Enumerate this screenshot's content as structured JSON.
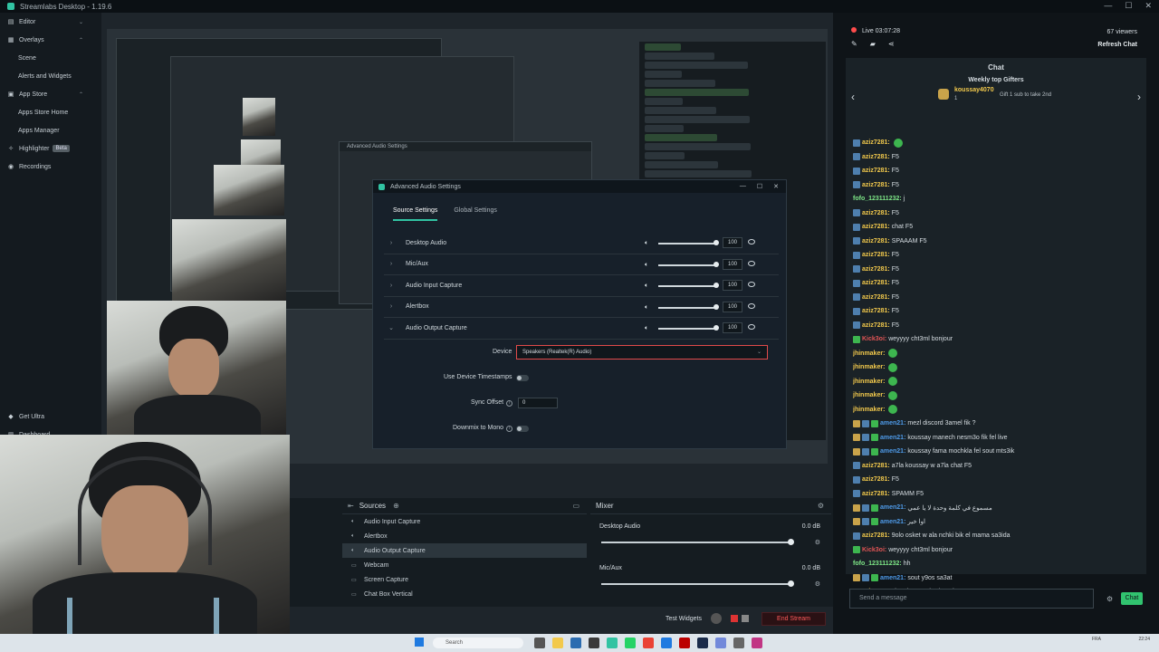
{
  "window": {
    "title": "Streamlabs Desktop - 1.19.6"
  },
  "sidebar": {
    "items": [
      {
        "label": "Editor",
        "level": 0
      },
      {
        "label": "Overlays",
        "level": 0
      },
      {
        "label": "Scene",
        "level": 1
      },
      {
        "label": "Alerts and Widgets",
        "level": 1
      },
      {
        "label": "App Store",
        "level": 0
      },
      {
        "label": "Apps Store Home",
        "level": 1
      },
      {
        "label": "Apps Manager",
        "level": 1
      },
      {
        "label": "Highlighter",
        "level": 0,
        "badge": "Beta"
      },
      {
        "label": "Recordings",
        "level": 0
      }
    ],
    "bottom": [
      {
        "label": "Get Ultra"
      },
      {
        "label": "Dashboard"
      }
    ]
  },
  "nested_dialog": {
    "title": "Advanced Audio Settings",
    "tabs": [
      "Source Settings",
      "Global Settings"
    ]
  },
  "audio_settings": {
    "title": "Advanced Audio Settings",
    "tabs": [
      "Source Settings",
      "Global Settings"
    ],
    "active_tab": "Source Settings",
    "rows": [
      {
        "name": "Desktop Audio",
        "value": "100",
        "expanded": false
      },
      {
        "name": "Mic/Aux",
        "value": "100",
        "expanded": false
      },
      {
        "name": "Audio Input Capture",
        "value": "100",
        "expanded": false
      },
      {
        "name": "Alertbox",
        "value": "100",
        "expanded": false
      },
      {
        "name": "Audio Output Capture",
        "value": "100",
        "expanded": true
      }
    ],
    "device_label": "Device",
    "device_value": "Speakers (Realtek(R) Audio)",
    "timestamps_label": "Use Device Timestamps",
    "sync_label": "Sync Offset",
    "sync_value": "0",
    "downmix_label": "Downmix to Mono"
  },
  "sources": {
    "title": "Sources",
    "items": [
      "Audio Input Capture",
      "Alertbox",
      "Audio Output Capture",
      "Webcam",
      "Screen Capture",
      "Chat Box Vertical"
    ],
    "active": "Audio Output Capture"
  },
  "mixer": {
    "title": "Mixer",
    "channels": [
      {
        "name": "Desktop Audio",
        "db": "0.0 dB"
      },
      {
        "name": "Mic/Aux",
        "db": "0.0 dB"
      }
    ]
  },
  "statusbar": {
    "test_widgets": "Test Widgets",
    "end_stream": "End Stream"
  },
  "stream": {
    "live_label": "Live 03:07:28",
    "viewers": "67 viewers",
    "refresh": "Refresh Chat"
  },
  "chat": {
    "title": "Chat",
    "gifters_title": "Weekly top Gifters",
    "top_gifter": "koussay4070",
    "top_count": "1",
    "gift_note": "Gift 1 sub to take 2nd",
    "input_placeholder": "Send a message",
    "send_button": "Chat",
    "messages": [
      {
        "user": "aziz7281:",
        "text": "",
        "emote": true,
        "color": "#f2c94c",
        "badges": [
          "blue"
        ]
      },
      {
        "user": "aziz7281:",
        "text": "F5",
        "color": "#f2c94c",
        "badges": [
          "blue"
        ]
      },
      {
        "user": "aziz7281:",
        "text": "F5",
        "color": "#f2c94c",
        "badges": [
          "blue"
        ]
      },
      {
        "user": "aziz7281:",
        "text": "F5",
        "color": "#f2c94c",
        "badges": [
          "blue"
        ]
      },
      {
        "user": "fofo_123111232:",
        "text": "j",
        "color": "#7ee787",
        "badges": []
      },
      {
        "user": "aziz7281:",
        "text": "F5",
        "color": "#f2c94c",
        "badges": [
          "blue"
        ]
      },
      {
        "user": "aziz7281:",
        "text": "chat F5",
        "color": "#f2c94c",
        "badges": [
          "blue"
        ]
      },
      {
        "user": "aziz7281:",
        "text": "SPAAAM F5",
        "color": "#f2c94c",
        "badges": [
          "blue"
        ]
      },
      {
        "user": "aziz7281:",
        "text": "F5",
        "color": "#f2c94c",
        "badges": [
          "blue"
        ]
      },
      {
        "user": "aziz7281:",
        "text": "F5",
        "color": "#f2c94c",
        "badges": [
          "blue"
        ]
      },
      {
        "user": "aziz7281:",
        "text": "F5",
        "color": "#f2c94c",
        "badges": [
          "blue"
        ]
      },
      {
        "user": "aziz7281:",
        "text": "F5",
        "color": "#f2c94c",
        "badges": [
          "blue"
        ]
      },
      {
        "user": "aziz7281:",
        "text": "F5",
        "color": "#f2c94c",
        "badges": [
          "blue"
        ]
      },
      {
        "user": "aziz7281:",
        "text": "F5",
        "color": "#f2c94c",
        "badges": [
          "blue"
        ]
      },
      {
        "user": "Kick3oi:",
        "text": "weyyyy cht3ml bonjour",
        "color": "#e05555",
        "badges": [
          "green"
        ]
      },
      {
        "user": "jhinmaker:",
        "text": "",
        "emote": true,
        "color": "#f2c94c",
        "badges": []
      },
      {
        "user": "jhinmaker:",
        "text": "",
        "emote": true,
        "color": "#f2c94c",
        "badges": []
      },
      {
        "user": "jhinmaker:",
        "text": "",
        "emote": true,
        "color": "#f2c94c",
        "badges": []
      },
      {
        "user": "jhinmaker:",
        "text": "",
        "emote": true,
        "color": "#f2c94c",
        "badges": []
      },
      {
        "user": "jhinmaker:",
        "text": "",
        "emote": true,
        "color": "#f2c94c",
        "badges": []
      },
      {
        "user": "amen21:",
        "text": "mezl discord 3amel fik ?",
        "color": "#4e9ae8",
        "badges": [
          "gold",
          "blue",
          "green"
        ]
      },
      {
        "user": "amen21:",
        "text": "koussay manech nesm3o fik fel live",
        "color": "#4e9ae8",
        "badges": [
          "gold",
          "blue",
          "green"
        ]
      },
      {
        "user": "amen21:",
        "text": "koussay fama mochkla fel sout mts3ik",
        "color": "#4e9ae8",
        "badges": [
          "gold",
          "blue",
          "green"
        ]
      },
      {
        "user": "aziz7281:",
        "text": "a7la koussay w a7la chat F5",
        "color": "#f2c94c",
        "badges": [
          "blue"
        ]
      },
      {
        "user": "aziz7281:",
        "text": "F5",
        "color": "#f2c94c",
        "badges": [
          "blue"
        ]
      },
      {
        "user": "aziz7281:",
        "text": "SPAMM F5",
        "color": "#f2c94c",
        "badges": [
          "blue"
        ]
      },
      {
        "user": "amen21:",
        "text": "مسموع في كلمة وحدة لا يا عمي",
        "color": "#4e9ae8",
        "badges": [
          "gold",
          "blue",
          "green"
        ]
      },
      {
        "user": "amen21:",
        "text": "اوا خير",
        "color": "#4e9ae8",
        "badges": [
          "gold",
          "blue",
          "green"
        ]
      },
      {
        "user": "aziz7281:",
        "text": "9olo osket w ala nchki bik el mama sa3ida",
        "color": "#f2c94c",
        "badges": [
          "blue"
        ]
      },
      {
        "user": "Kick3oi:",
        "text": "weyyyy cht3ml bonjour",
        "color": "#e05555",
        "badges": [
          "green"
        ]
      },
      {
        "user": "fofo_123111232:",
        "text": "hh",
        "color": "#7ee787",
        "badges": []
      },
      {
        "user": "amen21:",
        "text": "sout y9os sa3at",
        "color": "#4e9ae8",
        "badges": [
          "gold",
          "blue",
          "green"
        ]
      },
      {
        "user": "aziz7281:",
        "text": "slm 3l papa 9lewi 9oulo",
        "color": "#f2c94c",
        "badges": [
          "blue"
        ]
      }
    ]
  },
  "taskbar": {
    "search": "Search",
    "lang": "FRA",
    "time": "22:24"
  },
  "colors": {
    "accent": "#31c3a2",
    "danger": "#e04a4a",
    "live": "#ff4c4c"
  }
}
